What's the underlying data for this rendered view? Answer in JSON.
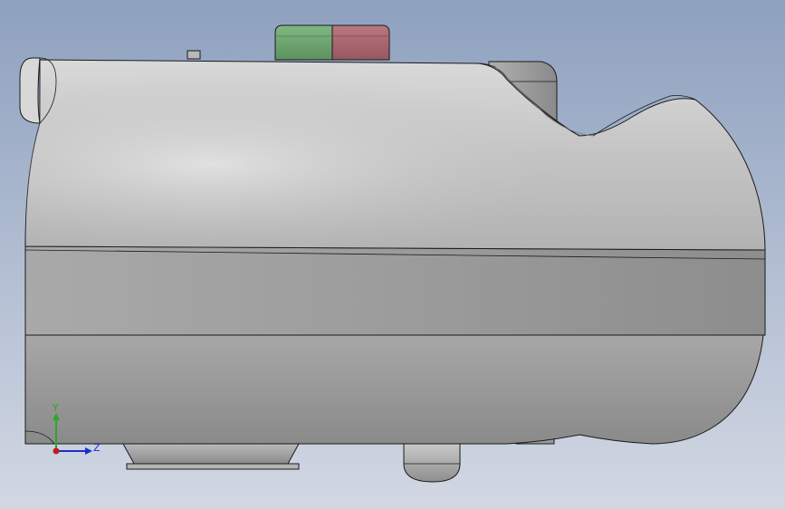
{
  "viewport": {
    "background_top": "#8fa2c0",
    "background_bottom": "#cfd6e2"
  },
  "model": {
    "body_color": "#9a9a9a",
    "edge_color": "#1a1a1a",
    "button_left_color": "#6aa06e",
    "button_right_color": "#a5646c"
  },
  "triad": {
    "y_label": "Y",
    "z_label": "Z",
    "y_color": "#2aa82a",
    "z_color": "#1b2fc9",
    "origin_color": "#c21b1b"
  }
}
